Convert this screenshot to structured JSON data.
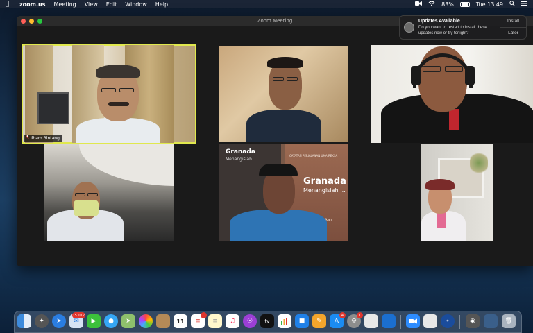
{
  "menubar": {
    "app_name": "zoom.us",
    "menus": [
      "Meeting",
      "View",
      "Edit",
      "Window",
      "Help"
    ],
    "battery": "83%",
    "clock": "Tue 13.49"
  },
  "window": {
    "title": "Zoom Meeting"
  },
  "participants": [
    {
      "name": "Ilham Bintang",
      "active_speaker": true,
      "muted": true
    }
  ],
  "shared_book": {
    "title": "Granada",
    "subtitle": "Menangislah ...",
    "series": "CATATAN PERJALANAN UMA REKSA",
    "author_fragment": "Rokan"
  },
  "notification": {
    "title": "Updates Available",
    "body": "Do you want to restart to install these updates now or try tonight?",
    "install_label": "Install",
    "later_label": "Later"
  },
  "dock": {
    "badges": {
      "mail": "15.012",
      "reminders": "1",
      "appstore": "4",
      "settings": "1"
    },
    "calendar_day": "11",
    "tv_label": "tv"
  }
}
